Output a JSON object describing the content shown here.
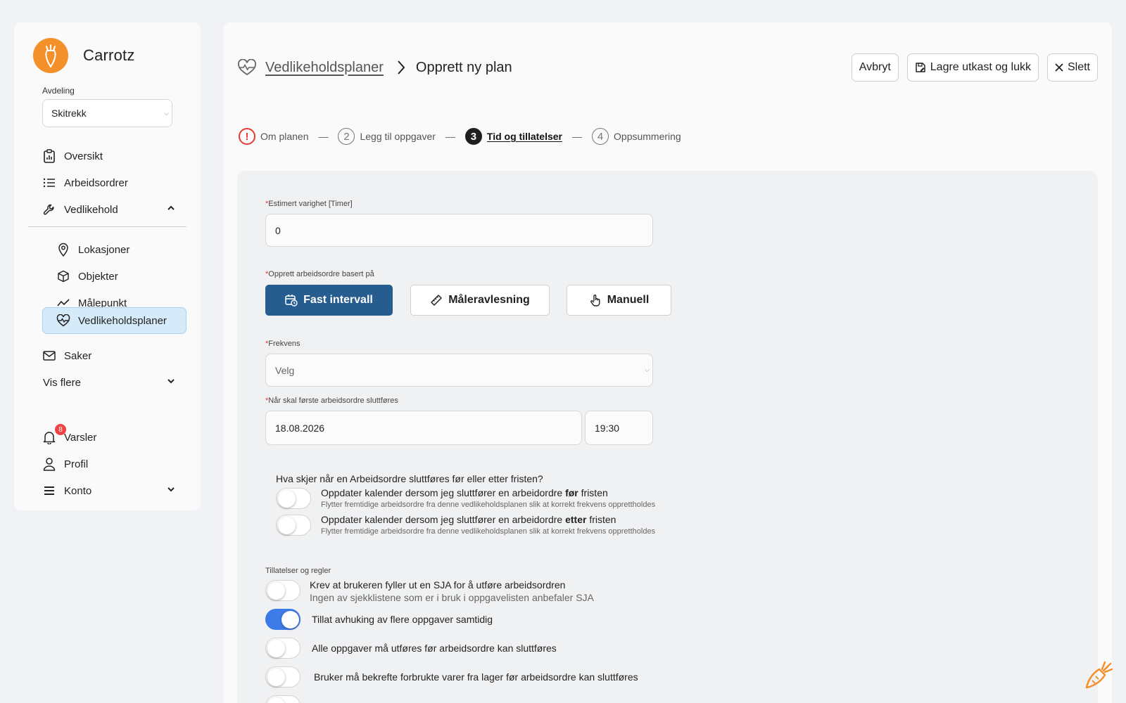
{
  "brand": {
    "name": "Carrotz"
  },
  "sidebar": {
    "dept_label": "Avdeling",
    "dept_value": "Skitrekk",
    "items": [
      {
        "label": "Oversikt",
        "icon": "clipboard-icon"
      },
      {
        "label": "Arbeidsordrer",
        "icon": "list-icon"
      },
      {
        "label": "Vedlikehold",
        "icon": "wrench-icon"
      },
      {
        "label": "Lokasjoner",
        "icon": "map-pin-icon"
      },
      {
        "label": "Objekter",
        "icon": "cube-icon"
      },
      {
        "label": "Målepunkt",
        "icon": "trend-line-icon"
      },
      {
        "label": "Vedlikeholdsplaner",
        "icon": "heart-pulse-icon"
      },
      {
        "label": "Saker",
        "icon": "mail-icon"
      },
      {
        "label": "Vis flere"
      },
      {
        "label": "Varsler",
        "icon": "bell-icon",
        "badge": "8"
      },
      {
        "label": "Profil",
        "icon": "user-icon"
      },
      {
        "label": "Konto",
        "icon": "menu-icon"
      }
    ]
  },
  "header": {
    "breadcrumb_link": "Vedlikeholdsplaner",
    "breadcrumb_current": "Opprett ny plan",
    "cancel_label": "Avbryt",
    "save_draft_label": "Lagre utkast og lukk",
    "delete_label": "Slett"
  },
  "steps": [
    {
      "num": "!",
      "label": "Om planen",
      "state": "error"
    },
    {
      "num": "2",
      "label": "Legg til oppgaver",
      "state": "default"
    },
    {
      "num": "3",
      "label": "Tid og tillatelser",
      "state": "current"
    },
    {
      "num": "4",
      "label": "Oppsummering",
      "state": "default"
    }
  ],
  "form": {
    "duration_label": "Estimert varighet [Timer]",
    "duration_value": "0",
    "basis_label": "Opprett arbeidsordre basert på",
    "basis_options": [
      "Fast intervall",
      "Måleravlesning",
      "Manuell"
    ],
    "basis_selected": "Fast intervall",
    "frequency_label": "Frekvens",
    "frequency_value": "Velg",
    "first_due_label": "Når skal første arbeidsordre sluttføres",
    "first_due_date": "18.08.2026",
    "first_due_time": "19:30",
    "question": "Hva skjer når en Arbeidsordre sluttføres før eller etter fristen?",
    "toggle_before": {
      "prefix": "Oppdater kalender dersom jeg sluttfører en arbeidordre ",
      "bold": "før",
      "suffix": " fristen",
      "desc": "Flytter fremtidige arbeidsordre fra denne vedlikeholdsplanen slik at korrekt frekvens opprettholdes",
      "on": false
    },
    "toggle_after": {
      "prefix": "Oppdater kalender dersom jeg sluttfører en arbeidordre ",
      "bold": "etter",
      "suffix": " fristen",
      "desc": "Flytter fremtidige arbeidsordre fra denne vedlikeholdsplanen slik at korrekt frekvens opprettholdes",
      "on": false
    },
    "permissions_label": "Tillatelser og regler",
    "permissions": [
      {
        "title": "Krev at brukeren fyller ut en SJA for å utføre arbeidsordren",
        "desc": "Ingen av sjekklistene som er i bruk i oppgavelisten anbefaler SJA",
        "on": false
      },
      {
        "title": "Tillat avhuking av flere oppgaver samtidig",
        "on": true
      },
      {
        "title": "Alle oppgaver må utføres før arbeidsordre kan sluttføres",
        "on": false
      },
      {
        "title": "Bruker må bekrefte forbrukte varer fra lager før arbeidsordre kan sluttføres",
        "on": false
      }
    ]
  },
  "colors": {
    "accent": "#275d8e",
    "toggle_on": "#3d7be9",
    "brand": "#f3902a",
    "error": "#e53935",
    "active_nav": "#d6ebfa"
  }
}
